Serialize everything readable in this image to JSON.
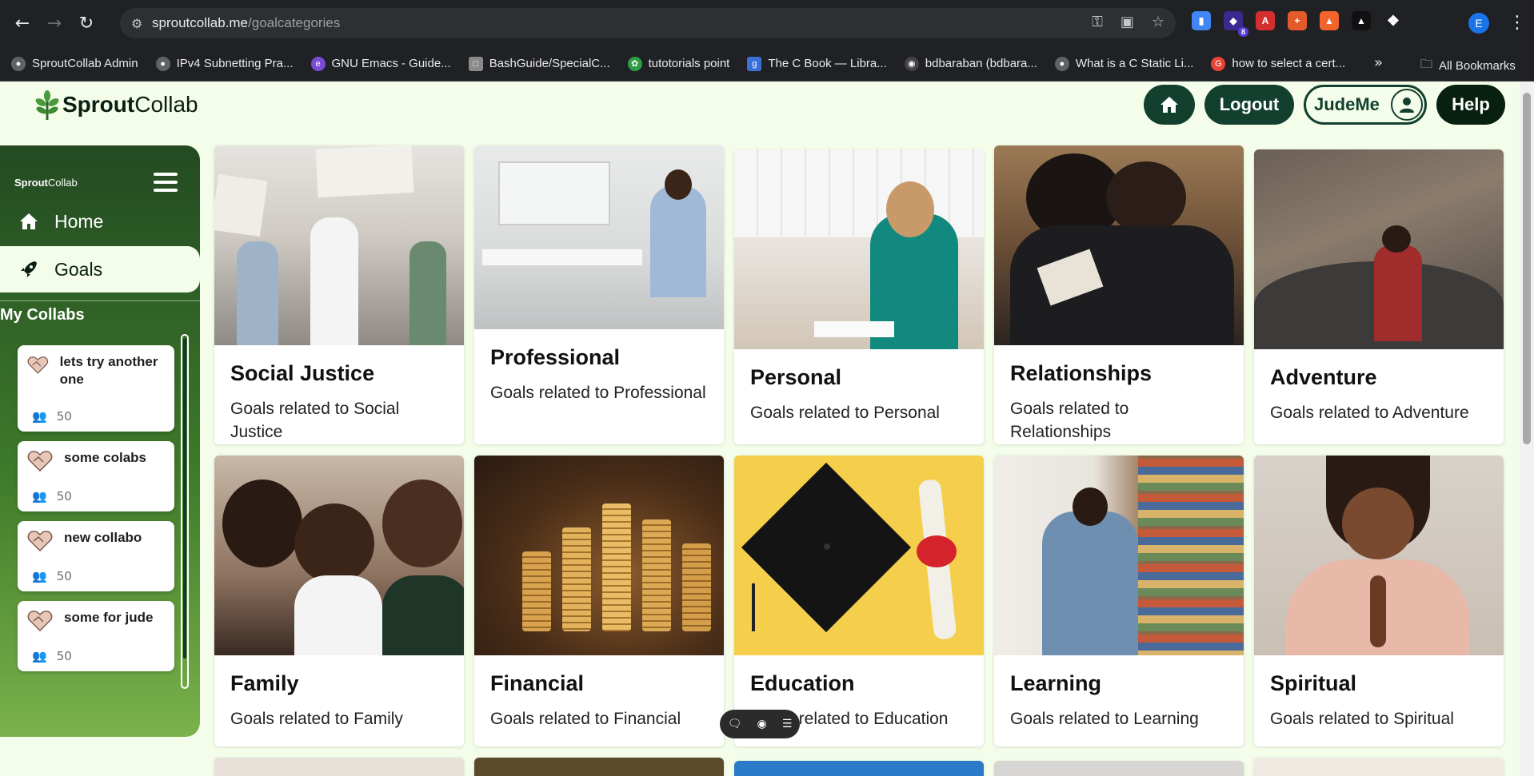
{
  "browser": {
    "url_host": "sproutcollab.me",
    "url_path": "/goalcategories",
    "profile_initial": "E",
    "extension_badge": "8",
    "bookmarks": [
      {
        "label": "SproutCollab Admin",
        "color": "#5f6368"
      },
      {
        "label": "IPv4 Subnetting Pra...",
        "color": "#5f6368"
      },
      {
        "label": "GNU Emacs - Guide...",
        "color": "#7b4bd6"
      },
      {
        "label": "BashGuide/SpecialC...",
        "color": "#8a8a8a"
      },
      {
        "label": "tutotorials point",
        "color": "#2e9e44"
      },
      {
        "label": "The C Book — Libra...",
        "color": "#3b6fd6"
      },
      {
        "label": "bdbaraban (bdbara...",
        "color": "#444"
      },
      {
        "label": "What is a C Static Li...",
        "color": "#5f6368"
      },
      {
        "label": "how to select a cert...",
        "color": "#ea4335"
      }
    ],
    "all_bookmarks": "All Bookmarks"
  },
  "header": {
    "logo_bold": "Sprout",
    "logo_rest": "Collab",
    "logout": "Logout",
    "username": "JudeMe",
    "help": "Help"
  },
  "sidebar": {
    "logo_bold": "Sprout",
    "logo_rest": "Collab",
    "items": [
      {
        "label": "Home",
        "active": false
      },
      {
        "label": "Goals",
        "active": true
      }
    ],
    "section_title": "My Collabs",
    "collabs": [
      {
        "title": "lets try another one",
        "members": "50"
      },
      {
        "title": "some colabs",
        "members": "50"
      },
      {
        "title": "new collabo",
        "members": "50"
      },
      {
        "title": "some for jude",
        "members": "50"
      }
    ]
  },
  "categories": [
    {
      "title": "Social Justice",
      "desc": "Goals related to Social Justice"
    },
    {
      "title": "Professional",
      "desc": "Goals related to Professional"
    },
    {
      "title": "Personal",
      "desc": "Goals related to Personal"
    },
    {
      "title": "Relationships",
      "desc": "Goals related to Relationships"
    },
    {
      "title": "Adventure",
      "desc": "Goals related to Adventure"
    },
    {
      "title": "Family",
      "desc": "Goals related to Family"
    },
    {
      "title": "Financial",
      "desc": "Goals related to Financial"
    },
    {
      "title": "Education",
      "desc": "Goals related to Education"
    },
    {
      "title": "Learning",
      "desc": "Goals related to Learning"
    },
    {
      "title": "Spiritual",
      "desc": "Goals related to Spiritual"
    }
  ]
}
